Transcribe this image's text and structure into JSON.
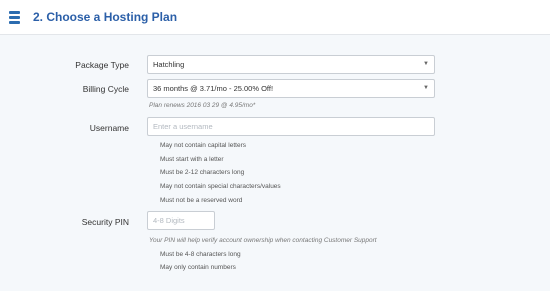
{
  "header": {
    "title": "2. Choose a Hosting Plan",
    "icon": "server-icon",
    "accent": "#2b5fa8"
  },
  "form": {
    "package_type": {
      "label": "Package Type",
      "value": "Hatchling"
    },
    "billing_cycle": {
      "label": "Billing Cycle",
      "value": "36 months @ 3.71/mo - 25.00% Off!",
      "note": "Plan renews 2016 03 29 @ 4.95/mo*"
    },
    "username": {
      "label": "Username",
      "placeholder": "Enter a username",
      "rules": [
        "May not contain capital letters",
        "Must start with a letter",
        "Must be 2-12 characters long",
        "May not contain special characters/values",
        "Must not be a reserved word"
      ]
    },
    "security_pin": {
      "label": "Security PIN",
      "placeholder": "4-8 Digits",
      "note": "Your PIN will help verify account ownership when contacting Customer Support",
      "rules": [
        "Must be 4-8 characters long",
        "May only contain numbers"
      ]
    }
  }
}
